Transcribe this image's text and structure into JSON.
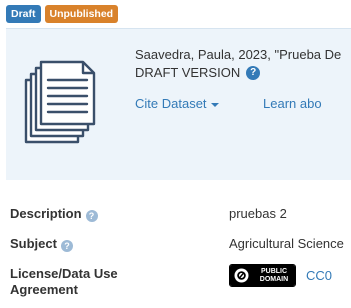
{
  "badges": {
    "draft": "Draft",
    "unpublished": "Unpublished"
  },
  "citation": {
    "line1": "Saavedra, Paula, 2023, \"Prueba De",
    "line2": "DRAFT VERSION",
    "help_symbol": "?"
  },
  "actions": {
    "cite": "Cite Dataset",
    "learn": "Learn abo"
  },
  "metadata": {
    "description": {
      "label": "Description",
      "value": "pruebas 2",
      "help_symbol": "?"
    },
    "subject": {
      "label": "Subject",
      "value": "Agricultural Science",
      "help_symbol": "?"
    },
    "license": {
      "label_line1": "License/Data Use",
      "label_line2": "Agreement",
      "badge_line1": "PUBLIC",
      "badge_line2": "DOMAIN",
      "value": "CC0"
    }
  },
  "colors": {
    "draft_badge": "#337ab7",
    "unpublished_badge": "#d9822b",
    "panel_background": "#edf4fa",
    "link": "#337ab7"
  },
  "icons": [
    "document-stack-icon",
    "help-icon",
    "caret-down-icon",
    "public-domain-icon"
  ]
}
